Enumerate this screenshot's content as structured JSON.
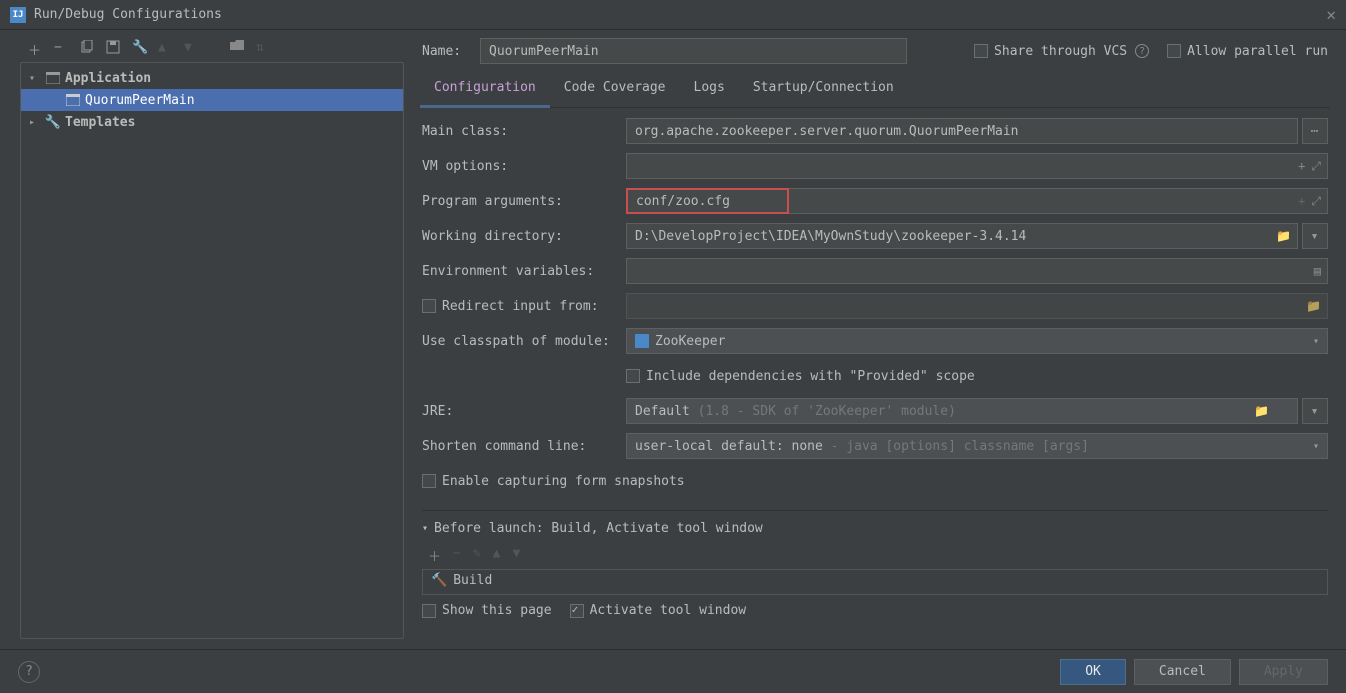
{
  "window": {
    "title": "Run/Debug Configurations"
  },
  "tree": {
    "application_label": "Application",
    "selected_config": "QuorumPeerMain",
    "templates_label": "Templates"
  },
  "name_row": {
    "label": "Name:",
    "value": "QuorumPeerMain",
    "share_label": "Share through VCS",
    "parallel_label": "Allow parallel run"
  },
  "tabs": {
    "configuration": "Configuration",
    "code_coverage": "Code Coverage",
    "logs": "Logs",
    "startup": "Startup/Connection"
  },
  "config": {
    "main_class_label": "Main class:",
    "main_class_value": "org.apache.zookeeper.server.quorum.QuorumPeerMain",
    "vm_options_label": "VM options:",
    "vm_options_value": "",
    "program_args_label": "Program arguments:",
    "program_args_value": "conf/zoo.cfg",
    "working_dir_label": "Working directory:",
    "working_dir_value": "D:\\DevelopProject\\IDEA\\MyOwnStudy\\zookeeper-3.4.14",
    "env_vars_label": "Environment variables:",
    "env_vars_value": "",
    "redirect_input_label": "Redirect input from:",
    "classpath_label": "Use classpath of module:",
    "classpath_value": "ZooKeeper",
    "include_provided_label": "Include dependencies with \"Provided\" scope",
    "jre_label": "JRE:",
    "jre_value": "Default",
    "jre_hint": "(1.8 - SDK of 'ZooKeeper' module)",
    "shorten_label": "Shorten command line:",
    "shorten_value": "user-local default: none",
    "shorten_hint": "- java [options] classname [args]",
    "snapshot_label": "Enable capturing form snapshots"
  },
  "before_launch": {
    "header": "Before launch: Build, Activate tool window",
    "build_item": "Build",
    "show_page_label": "Show this page",
    "activate_label": "Activate tool window"
  },
  "footer": {
    "ok": "OK",
    "cancel": "Cancel",
    "apply": "Apply"
  }
}
